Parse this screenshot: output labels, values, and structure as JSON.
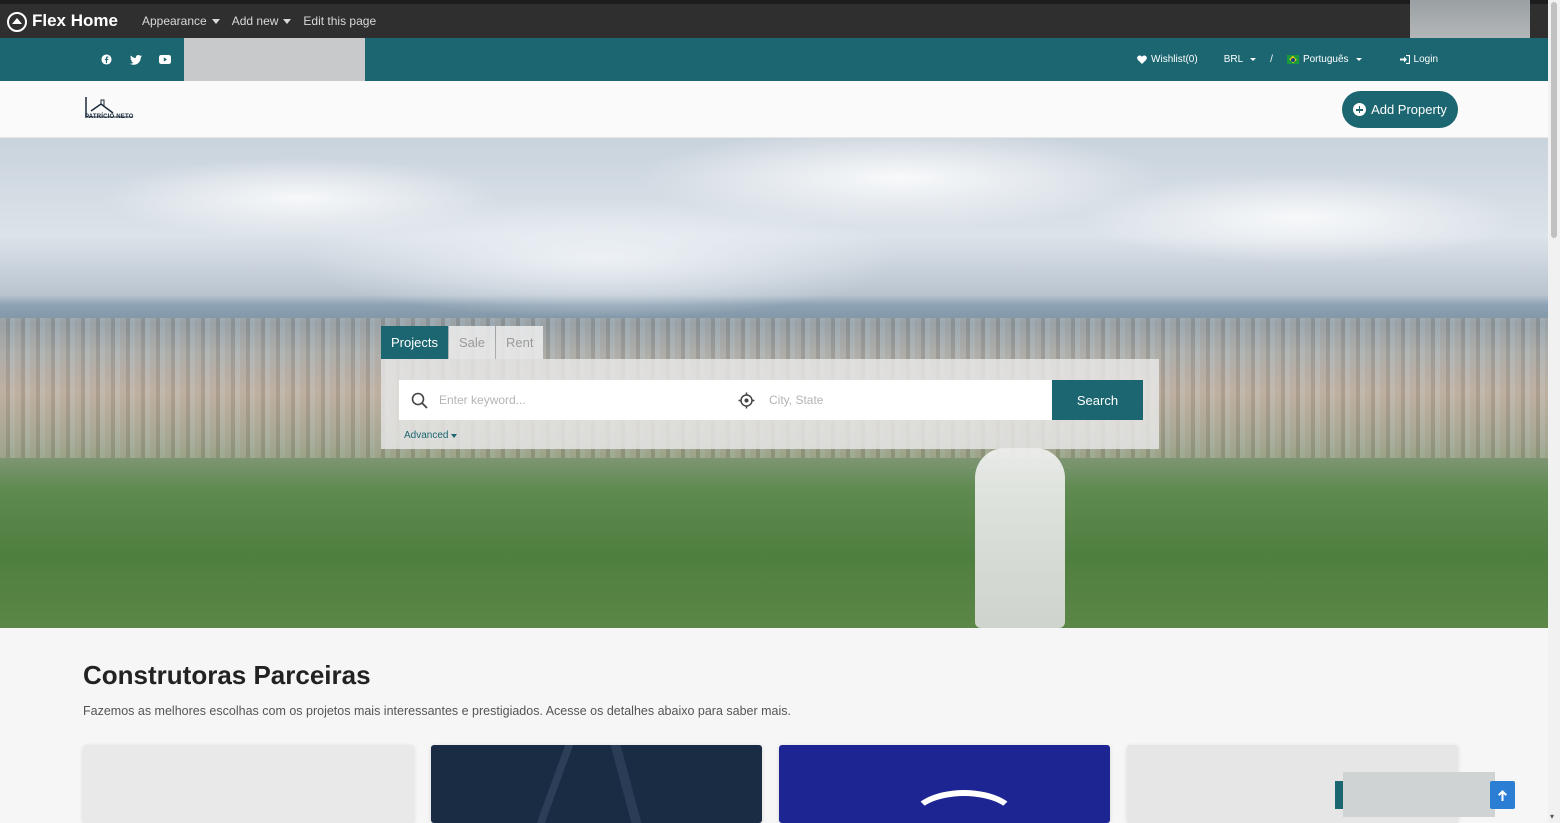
{
  "admin_bar": {
    "brand": "Flex Home",
    "menu": [
      {
        "label": "Appearance",
        "has_dropdown": true
      },
      {
        "label": "Add new",
        "has_dropdown": true
      },
      {
        "label": "Edit this page",
        "has_dropdown": false
      }
    ]
  },
  "top_bar": {
    "social_icons": [
      "facebook-icon",
      "twitter-icon",
      "youtube-icon"
    ],
    "wishlist": "Wishlist(0)",
    "currency": "BRL",
    "separator": "/",
    "language": "Português",
    "login": "Login"
  },
  "header": {
    "logo_text": "PATRÍCIO NETO",
    "add_property": "Add Property"
  },
  "search": {
    "tabs": [
      {
        "label": "Projects",
        "active": true
      },
      {
        "label": "Sale",
        "active": false
      },
      {
        "label": "Rent",
        "active": false
      }
    ],
    "keyword_placeholder": "Enter keyword...",
    "city_placeholder": "City, State",
    "button": "Search",
    "advanced": "Advanced"
  },
  "section": {
    "title": "Construtoras Parceiras",
    "subtitle": "Fazemos as melhores escolhas com os projetos mais interessantes e prestigiados. Acesse os detalhes abaixo para saber mais."
  },
  "colors": {
    "primary": "#1b6670",
    "admin_bar": "#2f2f2f",
    "back_to_top": "#2a7fd4"
  }
}
